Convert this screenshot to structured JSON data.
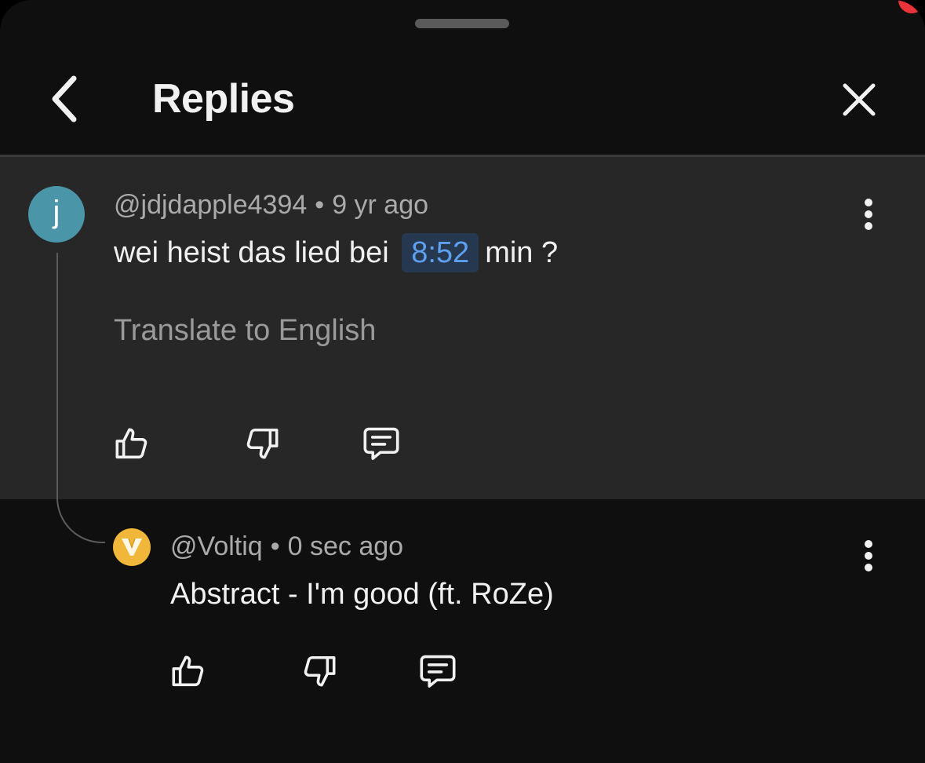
{
  "header": {
    "title": "Replies"
  },
  "icons": {
    "back": "chevron-left-icon",
    "close": "close-icon",
    "like": "thumb-up-icon",
    "dislike": "thumb-down-icon",
    "reply": "comment-icon",
    "more": "more-vertical-icon"
  },
  "colors": {
    "sheet_background": "#0f0f0f",
    "parent_comment_background": "#272727",
    "avatar_j": "#4a95a8",
    "avatar_v": "#f1b73a",
    "timestamp_link": "#5e9ff0",
    "notification": "#e8333b"
  },
  "parent_comment": {
    "avatar_letter": "j",
    "author": "@jdjdapple4394",
    "separator": "•",
    "time": "9 yr ago",
    "text_before": "wei heist das lied bei",
    "timestamp": "8:52",
    "text_after": "min ?",
    "translate_label": "Translate to English"
  },
  "reply": {
    "avatar_letter": "V",
    "author": "@Voltiq",
    "separator": "•",
    "time": "0 sec ago",
    "text": "Abstract - I'm good (ft. RoZe)"
  }
}
